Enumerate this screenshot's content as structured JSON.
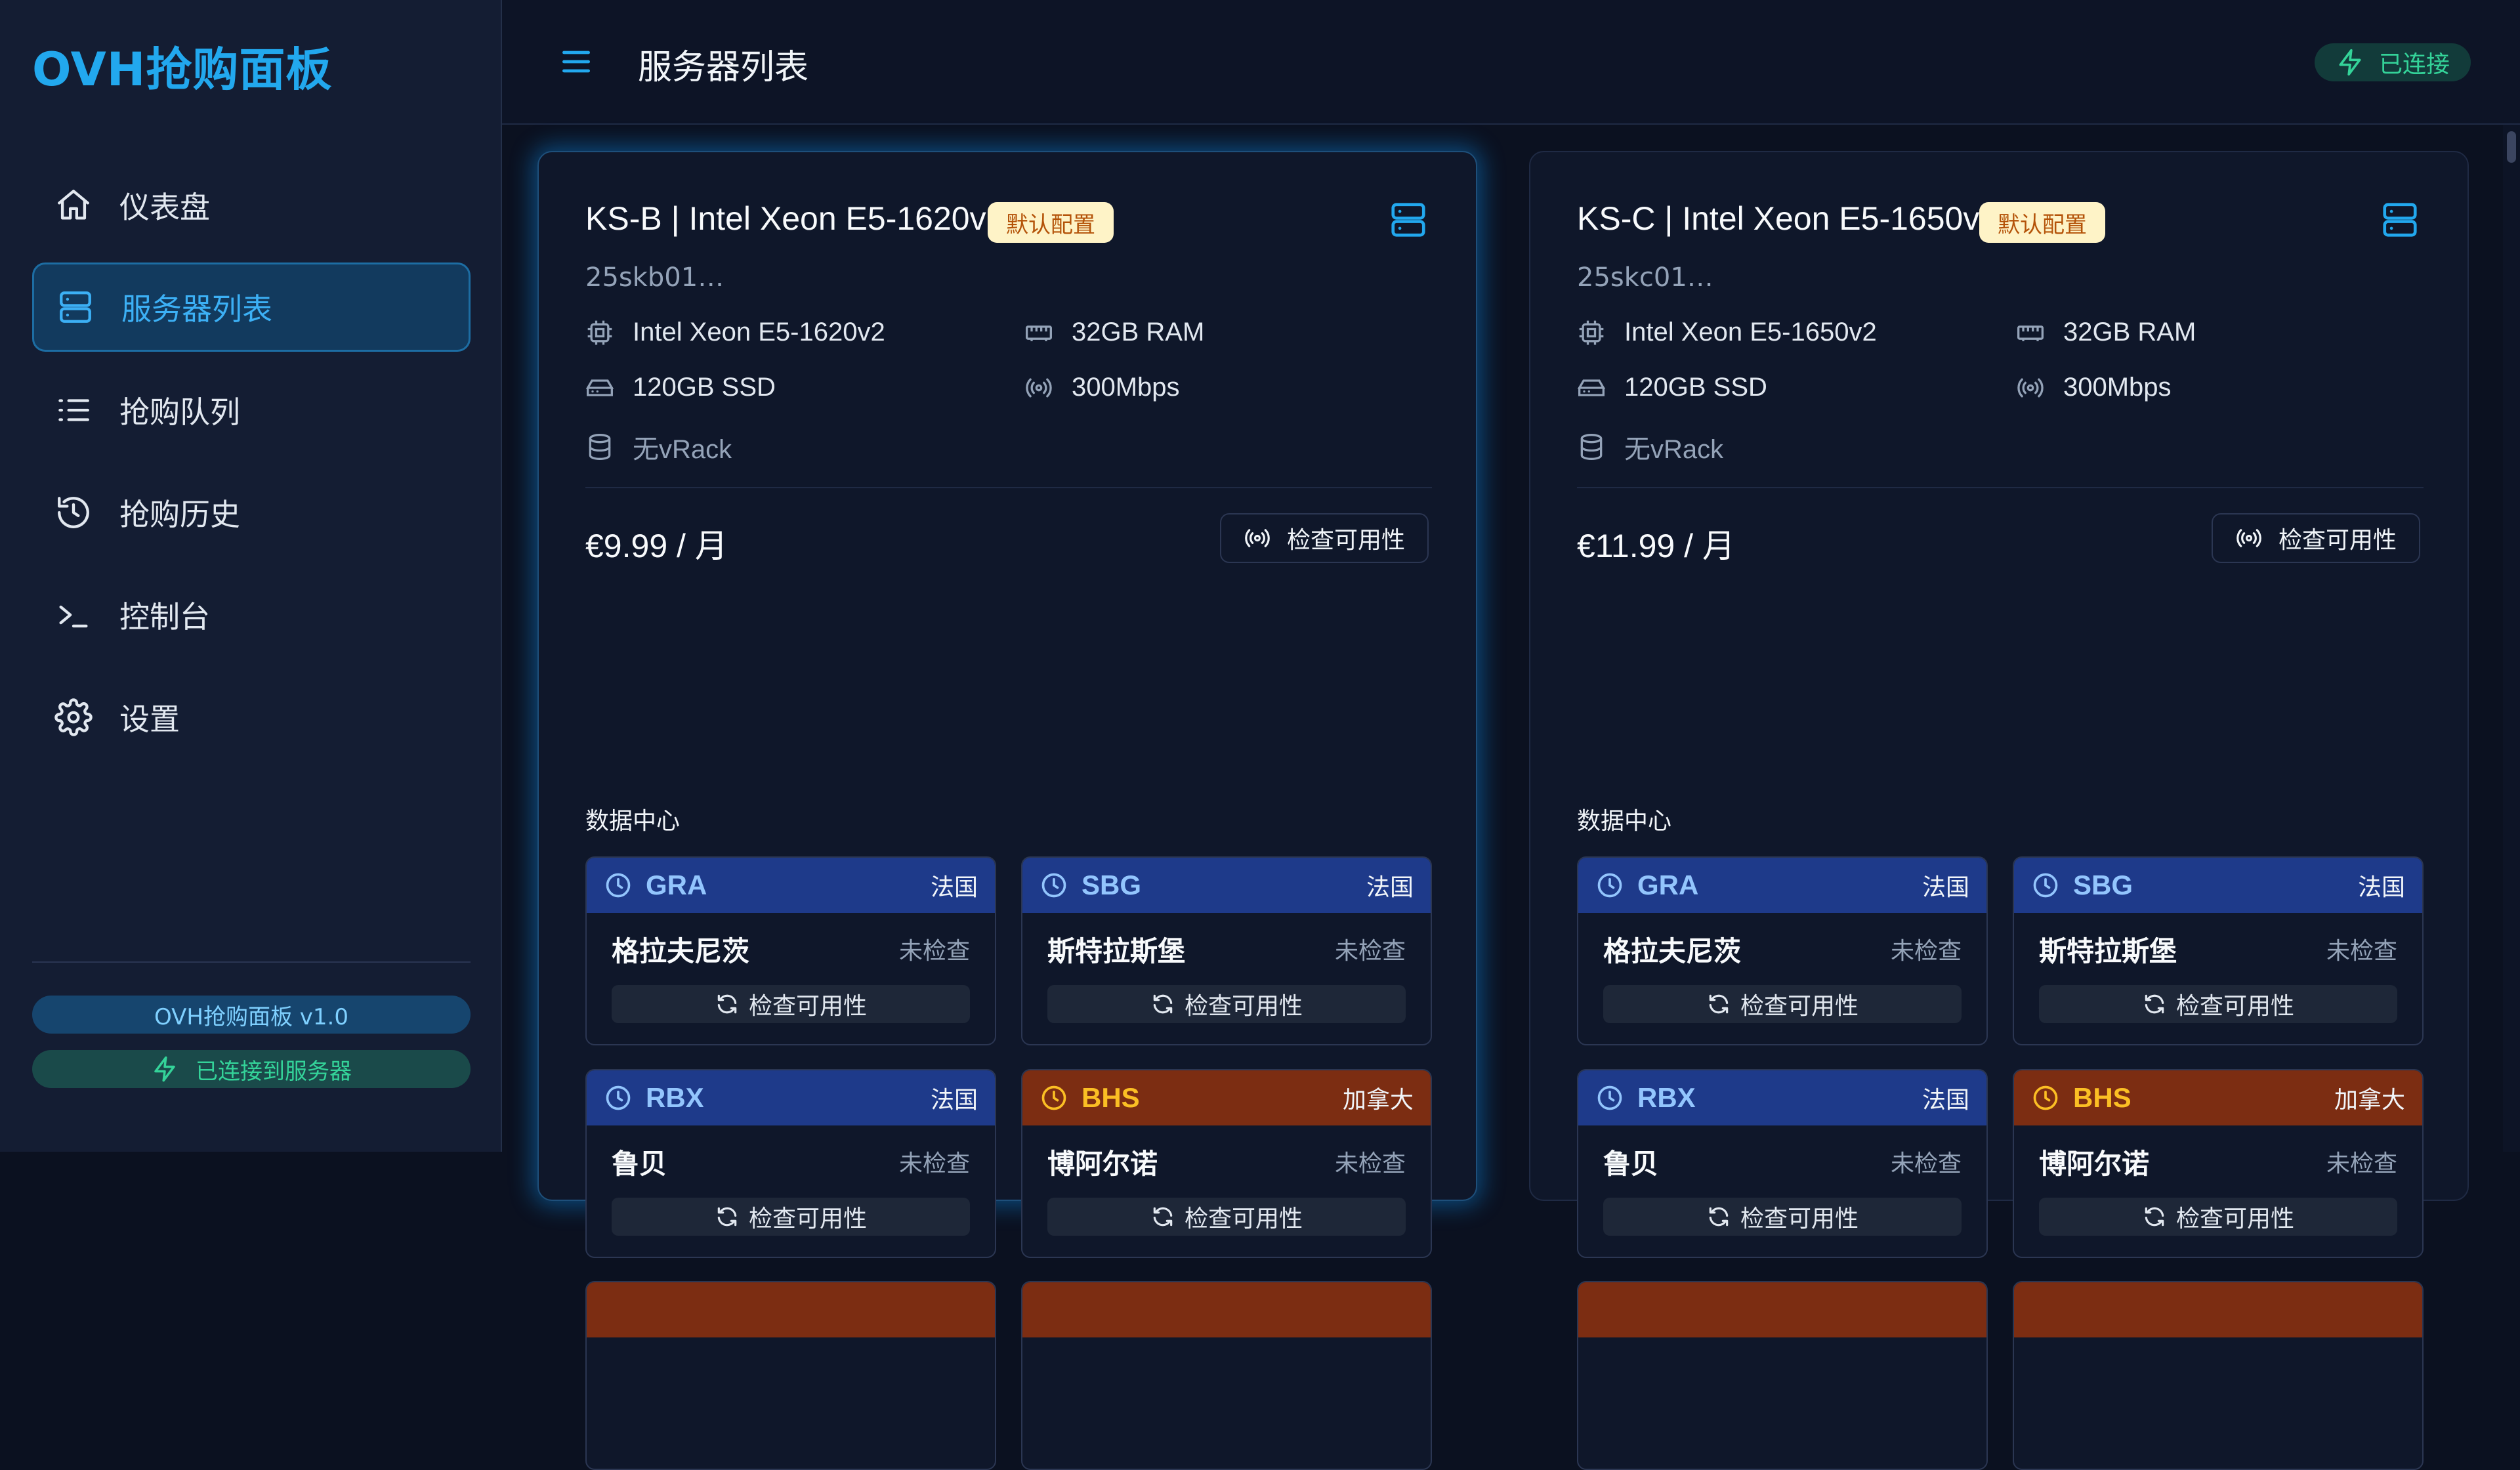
{
  "app": {
    "title": "OVH抢购面板"
  },
  "sidebar": {
    "items": [
      {
        "label": "仪表盘",
        "icon": "home-icon"
      },
      {
        "label": "服务器列表",
        "icon": "server-icon"
      },
      {
        "label": "抢购队列",
        "icon": "list-icon"
      },
      {
        "label": "抢购历史",
        "icon": "history-icon"
      },
      {
        "label": "控制台",
        "icon": "terminal-icon"
      },
      {
        "label": "设置",
        "icon": "gear-icon"
      }
    ],
    "active_index": 1,
    "version": "OVH抢购面板 v1.0",
    "connection": "已连接到服务器"
  },
  "header": {
    "title": "服务器列表",
    "status": "已连接"
  },
  "colors": {
    "accent": "#22a8ee",
    "success": "#34d399",
    "badge_bg": "#fef3c7",
    "badge_text": "#b45309",
    "france": "#1e3a8a",
    "canada": "#7c2d12"
  },
  "cards": [
    {
      "title": "KS-B | Intel Xeon E5-1620v2",
      "badge": "默认配置",
      "sku": "25skb01…",
      "cpu": "Intel Xeon E5-1620v2",
      "ram": "32GB RAM",
      "disk": "120GB SSD",
      "bandwidth": "300Mbps",
      "vrack": "无vRack",
      "price": "€9.99 / 月",
      "check_label": "检查可用性",
      "dc_heading": "数据中心",
      "datacenters": [
        {
          "code": "GRA",
          "country": "法国",
          "city": "格拉夫尼茨",
          "status": "未检查",
          "action": "检查可用性"
        },
        {
          "code": "SBG",
          "country": "法国",
          "city": "斯特拉斯堡",
          "status": "未检查",
          "action": "检查可用性"
        },
        {
          "code": "RBX",
          "country": "法国",
          "city": "鲁贝",
          "status": "未检查",
          "action": "检查可用性"
        },
        {
          "code": "BHS",
          "country": "加拿大",
          "city": "博阿尔诺",
          "status": "未检查",
          "action": "检查可用性"
        }
      ]
    },
    {
      "title": "KS-C | Intel Xeon E5-1650v2",
      "badge": "默认配置",
      "sku": "25skc01…",
      "cpu": "Intel Xeon E5-1650v2",
      "ram": "32GB RAM",
      "disk": "120GB SSD",
      "bandwidth": "300Mbps",
      "vrack": "无vRack",
      "price": "€11.99 / 月",
      "check_label": "检查可用性",
      "dc_heading": "数据中心",
      "datacenters": [
        {
          "code": "GRA",
          "country": "法国",
          "city": "格拉夫尼茨",
          "status": "未检查",
          "action": "检查可用性"
        },
        {
          "code": "SBG",
          "country": "法国",
          "city": "斯特拉斯堡",
          "status": "未检查",
          "action": "检查可用性"
        },
        {
          "code": "RBX",
          "country": "法国",
          "city": "鲁贝",
          "status": "未检查",
          "action": "检查可用性"
        },
        {
          "code": "BHS",
          "country": "加拿大",
          "city": "博阿尔诺",
          "status": "未检查",
          "action": "检查可用性"
        }
      ]
    }
  ]
}
